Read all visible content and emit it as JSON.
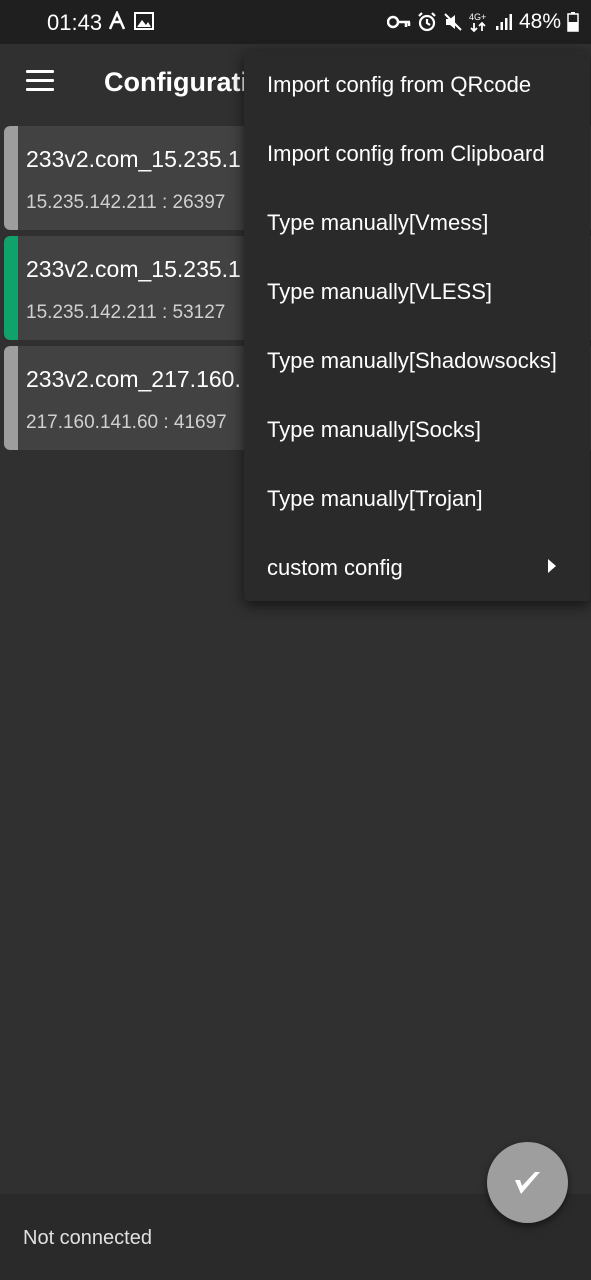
{
  "status_bar": {
    "time": "01:43",
    "battery": "48%",
    "icons": [
      "vpn-key-icon",
      "alarm-icon",
      "mute-icon",
      "network-4g-icon",
      "signal-icon",
      "battery-icon"
    ]
  },
  "app_bar": {
    "title": "Configurati"
  },
  "servers": [
    {
      "name": "233v2.com_15.235.1",
      "address": "15.235.142.211 : 26397",
      "selected": false
    },
    {
      "name": "233v2.com_15.235.1",
      "address": "15.235.142.211 : 53127",
      "selected": true
    },
    {
      "name": "233v2.com_217.160.",
      "address": "217.160.141.60 : 41697",
      "selected": false
    }
  ],
  "popup_menu": {
    "items": [
      {
        "label": "Import config from QRcode"
      },
      {
        "label": "Import config from Clipboard"
      },
      {
        "label": "Type manually[Vmess]"
      },
      {
        "label": "Type manually[VLESS]"
      },
      {
        "label": "Type manually[Shadowsocks]"
      },
      {
        "label": "Type manually[Socks]"
      },
      {
        "label": "Type manually[Trojan]"
      },
      {
        "label": "custom config",
        "has_submenu": true
      }
    ]
  },
  "bottom_bar": {
    "status": "Not connected"
  },
  "colors": {
    "selected_stripe": "#0fa36b",
    "unselected_stripe": "#9e9e9e"
  }
}
